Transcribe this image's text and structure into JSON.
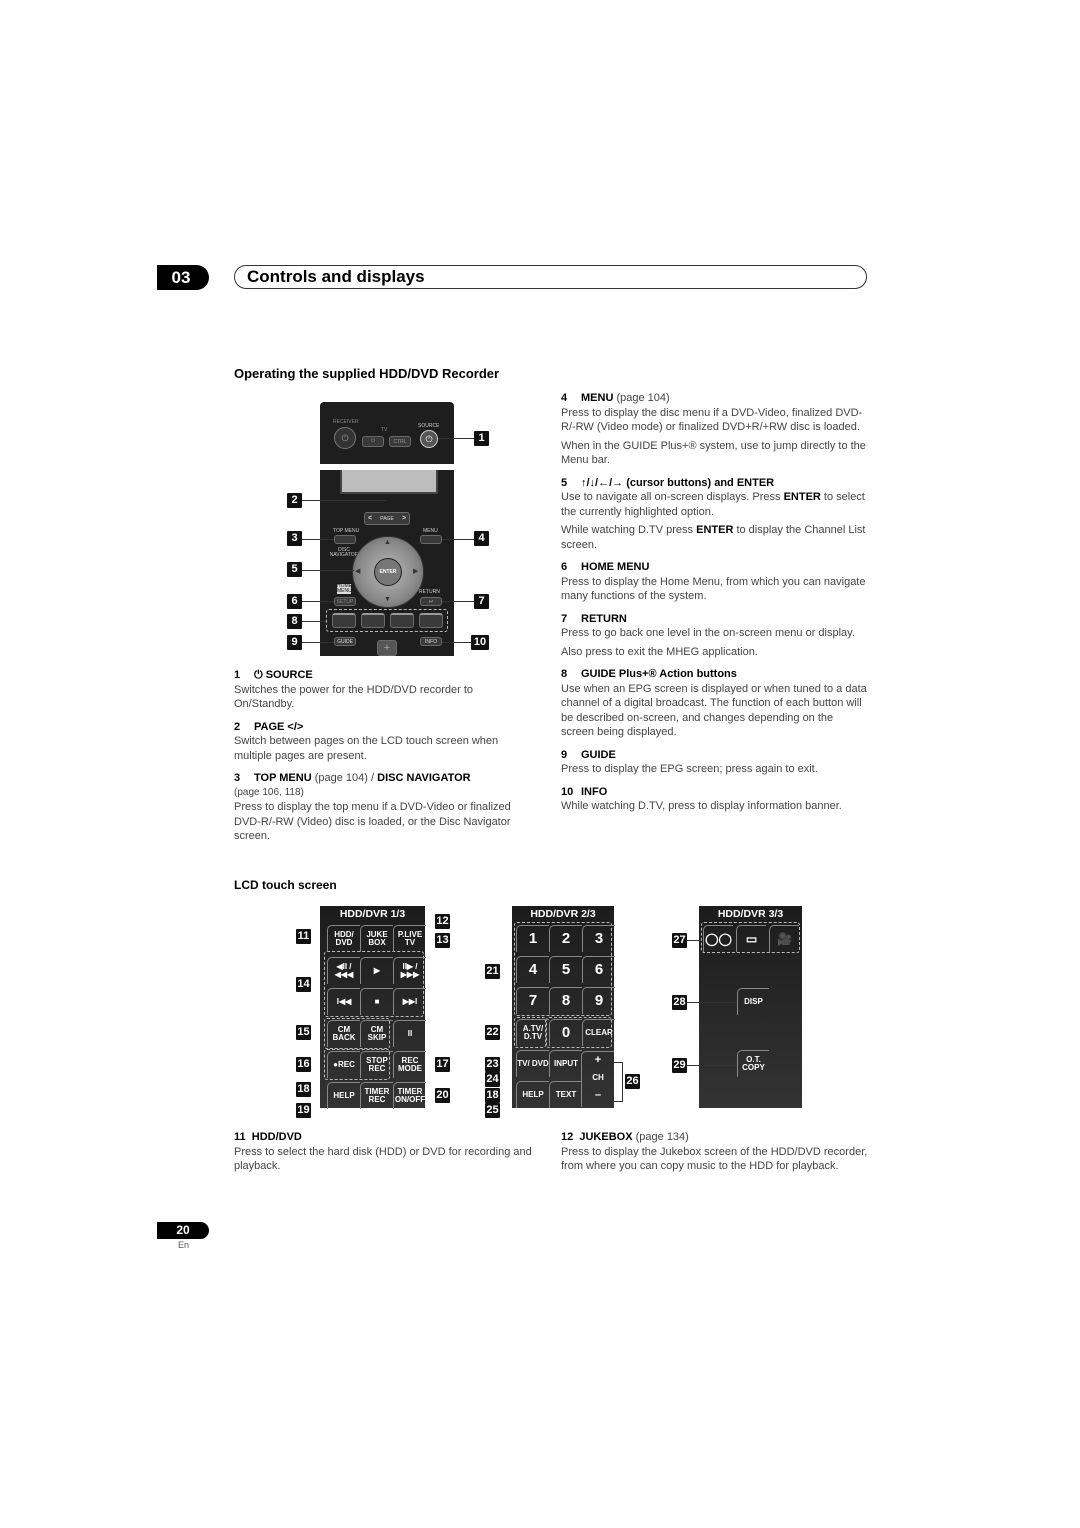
{
  "header": {
    "chapter_number": "03",
    "chapter_title": "Controls and displays"
  },
  "section": {
    "title": "Operating the supplied HDD/DVD Recorder"
  },
  "remote": {
    "receiver_label": "RECEIVER",
    "tv_label": "TV",
    "ctrl_label": "CTRL",
    "source_label": "SOURCE",
    "page_label": "PAGE",
    "page_left": "<",
    "page_right": ">",
    "top_menu_label": "TOP MENU",
    "disc_navigator_label": "DISC NAVIGATOR",
    "menu_label": "MENU",
    "enter_label": "ENTER",
    "home_menu_label": "HOME MENU",
    "setup_label": "SETUP",
    "return_label": "RETURN",
    "guide_label": "GUIDE",
    "info_label": "INFO",
    "plus_label": "+",
    "power_glyph": "⏻",
    "return_glyph": "↩",
    "callouts": [
      "1",
      "2",
      "3",
      "4",
      "5",
      "6",
      "7",
      "8",
      "9",
      "10"
    ]
  },
  "left_items": [
    {
      "num": "1",
      "icon": "power-icon",
      "icon_glyph": "⏻",
      "title": "SOURCE",
      "page": "",
      "lines": [
        "Switches the power for the HDD/DVD recorder to On/Standby."
      ]
    },
    {
      "num": "2",
      "title": "PAGE </>",
      "page": "",
      "lines": [
        "Switch between pages on the LCD touch screen when multiple pages are present."
      ]
    },
    {
      "num": "3",
      "title": "TOP MENU",
      "page": "(page 104) /",
      "title2": "DISC NAVIGATOR",
      "page2": "(page 106, 118)",
      "lines": [
        "Press to display the top menu if a DVD-Video or finalized DVD-R/-RW (Video) disc is loaded, or the Disc Navigator screen."
      ]
    }
  ],
  "right_items": [
    {
      "num": "4",
      "title": "MENU",
      "page": "(page 104)",
      "lines": [
        "Press to display the disc menu if a DVD-Video, finalized DVD-R/-RW (Video mode) or finalized DVD+R/+RW disc is loaded.",
        "When in the GUIDE Plus+® system, use to jump directly to the Menu bar."
      ]
    },
    {
      "num": "5",
      "title": "↑/↓/←/→ (cursor buttons) and ENTER",
      "page": "",
      "p1_before": "Use to navigate all on-screen displays. Press ",
      "p1_bold": "ENTER",
      "p1_after": " to select the currently highlighted option.",
      "p2_before": "While watching D.TV press ",
      "p2_bold": "ENTER",
      "p2_after": " to display the Channel List screen."
    },
    {
      "num": "6",
      "title": "HOME MENU",
      "page": "",
      "lines": [
        "Press to display the Home Menu, from which you can navigate many functions of the system."
      ]
    },
    {
      "num": "7",
      "title": "RETURN",
      "page": "",
      "lines": [
        "Press to go back one level in the on-screen menu or display.",
        "Also press to exit the MHEG application."
      ]
    },
    {
      "num": "8",
      "title": "GUIDE Plus+® Action buttons",
      "page": "",
      "lines": [
        "Use when an EPG screen is displayed or when tuned to a data channel of a digital broadcast. The function of each button will be described on-screen, and changes depending on the screen being displayed."
      ]
    },
    {
      "num": "9",
      "title": "GUIDE",
      "page": "",
      "lines": [
        "Press to display the EPG screen; press again to exit."
      ]
    },
    {
      "num": "10",
      "title": "INFO",
      "page": "",
      "lines": [
        "While watching D.TV, press to display information banner."
      ]
    }
  ],
  "lcd": {
    "heading": "LCD touch screen",
    "panel1": {
      "title": "HDD/DVR  1/3",
      "buttons": [
        "HDD/ DVD",
        "JUKE BOX",
        "P.LIVE TV",
        "◀II / ◀◀◀",
        "▶",
        "II▶ / ▶▶▶",
        "I◀◀",
        "■",
        "▶▶I",
        "CM BACK",
        "CM SKIP",
        "II",
        "●REC",
        "STOP REC",
        "REC MODE",
        "HELP",
        "TIMER REC",
        "TIMER ON/OFF"
      ],
      "callouts": [
        "11",
        "12",
        "13",
        "14",
        "15",
        "16",
        "17",
        "18",
        "19",
        "20"
      ]
    },
    "panel2": {
      "title": "HDD/DVR  2/3",
      "buttons": [
        "1",
        "2",
        "3",
        "4",
        "5",
        "6",
        "7",
        "8",
        "9",
        "A.TV/ D.TV",
        "0",
        "CLEAR",
        "TV/ DVD",
        "INPUT",
        "HELP",
        "TEXT"
      ],
      "ch_plus": "+",
      "ch_label": "CH",
      "ch_minus": "–",
      "callouts": [
        "21",
        "22",
        "23",
        "24",
        "18",
        "25",
        "26"
      ]
    },
    "panel3": {
      "title": "HDD/DVR  3/3",
      "icon_buttons": [
        "audio-icon",
        "subtitle-icon",
        "camera-angle-icon"
      ],
      "disp_label": "DISP",
      "otcopy_label": "O.T. COPY",
      "callouts": [
        "27",
        "28",
        "29"
      ]
    }
  },
  "bottom_items": [
    {
      "num": "11",
      "title": "HDD/DVD",
      "page": "",
      "lines": [
        "Press to select the hard disk (HDD) or DVD for recording and playback."
      ]
    },
    {
      "num": "12",
      "title": "JUKEBOX",
      "page": "(page 134)",
      "lines": [
        "Press to display the Jukebox screen of the HDD/DVD recorder, from where you can copy music to the HDD for playback."
      ]
    }
  ],
  "footer": {
    "page_number": "20",
    "language": "En"
  }
}
